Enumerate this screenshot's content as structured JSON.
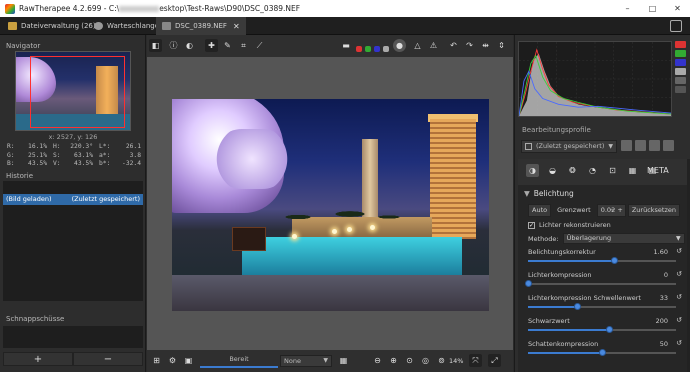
{
  "titlebar": {
    "app": "RawTherapee 4.2.699 -",
    "path_start": "C:\\",
    "path_end": "esktop\\Test-Raws\\D90\\DSC_0389.NEF",
    "min": "–",
    "max": "□",
    "close": "✕"
  },
  "tabs": [
    {
      "label": "Dateiverwaltung (26)"
    },
    {
      "label": "Warteschlange"
    },
    {
      "label": "DSC_0389.NEF",
      "close": "✕"
    }
  ],
  "navigator": {
    "title": "Navigator",
    "coords": "x: 2527, y: 126",
    "rows": [
      [
        "R:",
        "16.1%",
        "H:",
        "220.3°",
        "L*:",
        "26.1"
      ],
      [
        "G:",
        "25.1%",
        "S:",
        "63.1%",
        "a*:",
        "3.8"
      ],
      [
        "B:",
        "43.5%",
        "V:",
        "43.5%",
        "b*:",
        "-32.4"
      ]
    ]
  },
  "history": {
    "title": "Historie",
    "row_left": "(Bild geladen)",
    "row_right": "(Zuletzt gespeichert)"
  },
  "snapshots": {
    "title": "Schnappschüsse",
    "add": "+",
    "remove": "−"
  },
  "bottom": {
    "ready": "Bereit",
    "none": "None",
    "zoom": "14%"
  },
  "profiles": {
    "title": "Bearbeitungsprofile",
    "selected": "(Zuletzt gespeichert)"
  },
  "exposure": {
    "title": "Belichtung",
    "auto": "Auto",
    "clip_label": "Grenzwert",
    "clip_value": "0.02",
    "reset": "Zurücksetzen",
    "reconstruct": "Lichter rekonstruieren",
    "method_label": "Methode:",
    "method_value": "Überlagerung",
    "sliders": [
      {
        "label": "Belichtungskorrektur",
        "value": "1.60",
        "fraction": 0.58
      },
      {
        "label": "Lichterkompression",
        "value": "0",
        "fraction": 0.0
      },
      {
        "label": "Lichterkompression Schwellenwert",
        "value": "33",
        "fraction": 0.33
      },
      {
        "label": "Schwarzwert",
        "value": "200",
        "fraction": 0.55
      },
      {
        "label": "Schattenkompression",
        "value": "50",
        "fraction": 0.5
      }
    ]
  },
  "icons": {
    "meta": "META"
  }
}
